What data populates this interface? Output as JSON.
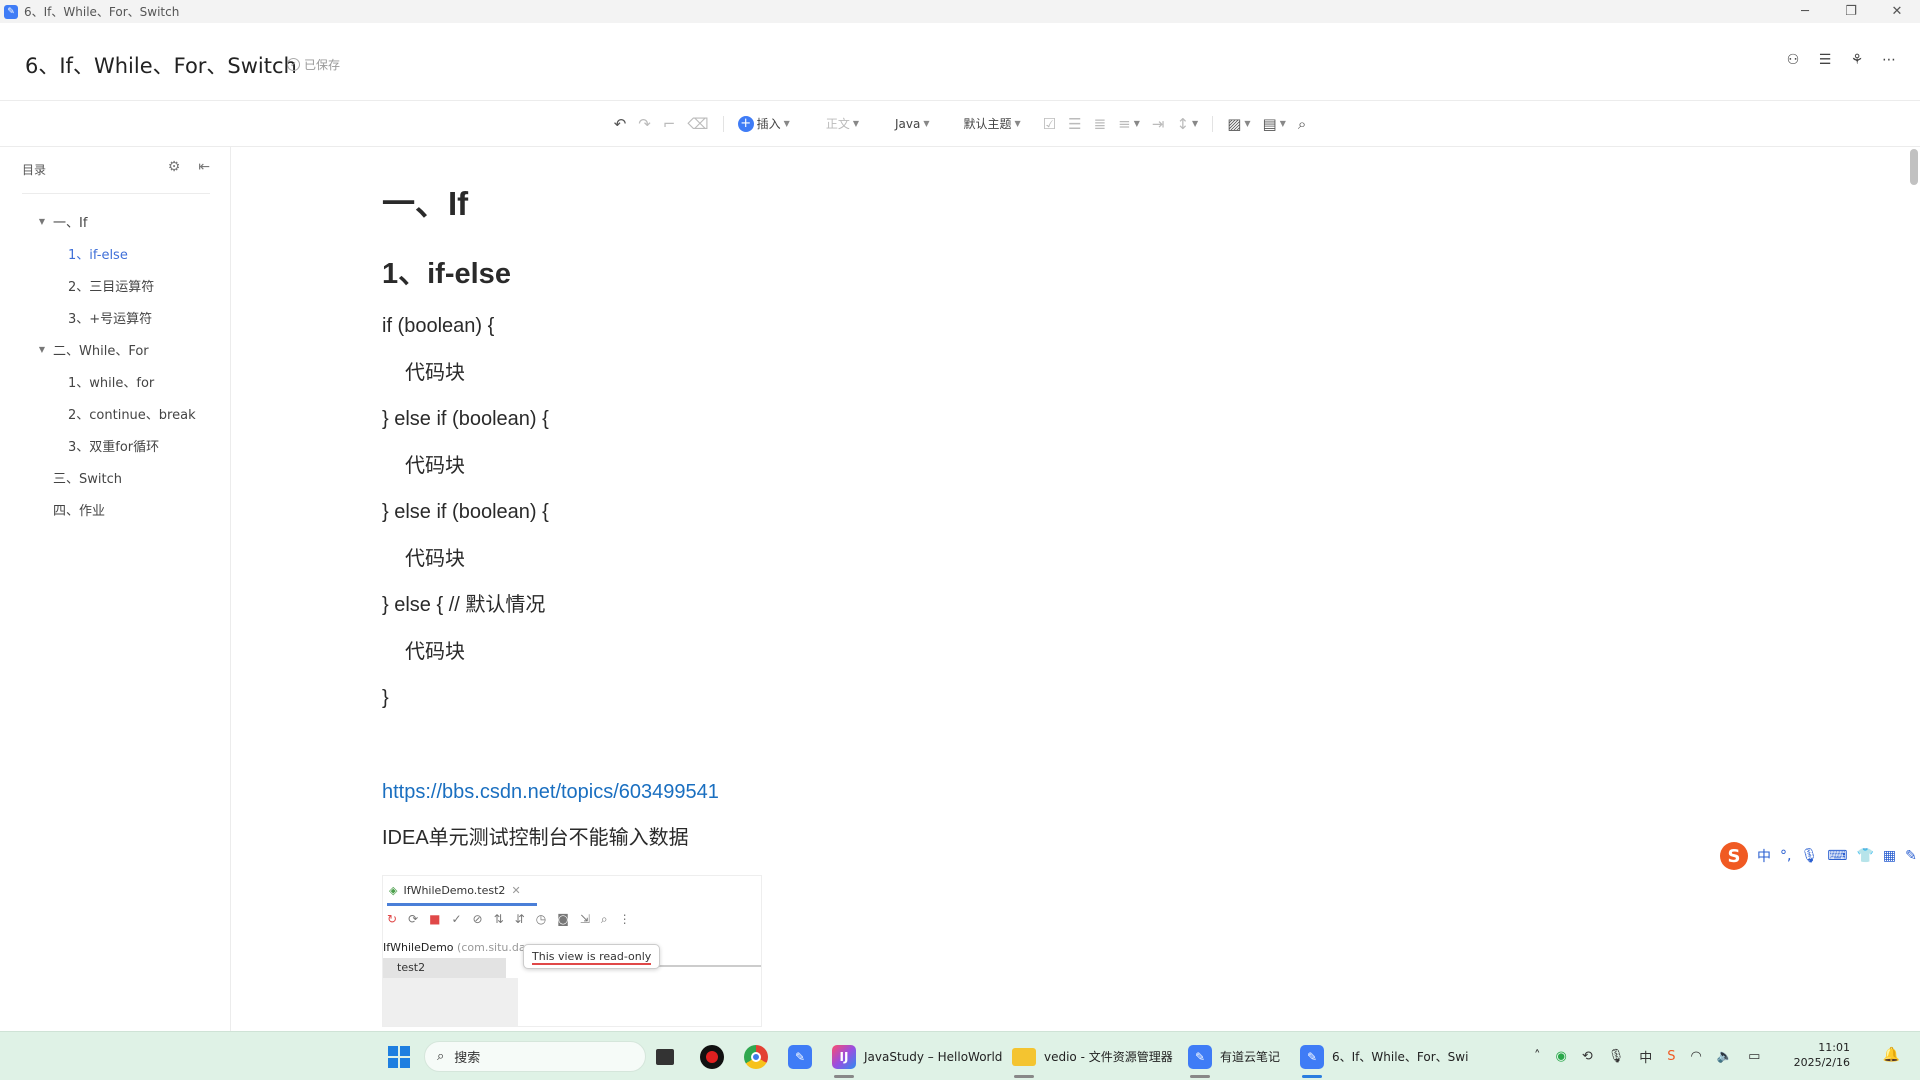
{
  "window": {
    "title": "6、If、While、For、Switch",
    "controls": {
      "minimize": "─",
      "restore": "❐",
      "close": "✕"
    }
  },
  "header": {
    "doc_title": "6、If、While、For、Switch",
    "saved_label": "已保存"
  },
  "toolbar": {
    "insert_label": "插入",
    "paragraph_label": "正文",
    "language_label": "Java",
    "theme_label": "默认主题"
  },
  "toc": {
    "title": "目录",
    "items": [
      {
        "label": "一、If",
        "level": 1,
        "expanded": true
      },
      {
        "label": "1、if-else",
        "level": 2,
        "active": true
      },
      {
        "label": "2、三目运算符",
        "level": 2
      },
      {
        "label": "3、+号运算符",
        "level": 2
      },
      {
        "label": "二、While、For",
        "level": 1,
        "expanded": true
      },
      {
        "label": "1、while、for",
        "level": 2
      },
      {
        "label": "2、continue、break",
        "level": 2
      },
      {
        "label": "3、双重for循环",
        "level": 2
      },
      {
        "label": "三、Switch",
        "level": 1
      },
      {
        "label": "四、作业",
        "level": 1
      }
    ]
  },
  "document": {
    "h1": "一、If",
    "h2": "1、if-else",
    "code_lines": [
      {
        "text": "if (boolean) {",
        "indent": false
      },
      {
        "text": "代码块",
        "indent": true
      },
      {
        "text": "} else if (boolean) {",
        "indent": false
      },
      {
        "text": "代码块",
        "indent": true
      },
      {
        "text": "} else if (boolean) {",
        "indent": false
      },
      {
        "text": "代码块",
        "indent": true
      },
      {
        "text": "} else { // 默认情况",
        "indent": false
      },
      {
        "text": "代码块",
        "indent": true
      },
      {
        "text": "}",
        "indent": false
      }
    ],
    "link": "https://bbs.csdn.net/topics/603499541",
    "note": "IDEA单元测试控制台不能输入数据",
    "embedded": {
      "tab_label": "IfWhileDemo.test2",
      "class_label": "IfWhileDemo",
      "package_label": "(com.situ.da",
      "test_label": "test2",
      "tooltip": "This view is read-only"
    }
  },
  "ime": {
    "lang": "中",
    "punct": "°,"
  },
  "taskbar": {
    "search_placeholder": "搜索",
    "apps": [
      {
        "label": "JavaStudy – HelloWorld"
      },
      {
        "label": "vedio - 文件资源管理器"
      },
      {
        "label": "有道云笔记"
      },
      {
        "label": "6、If、While、For、Swi"
      }
    ],
    "ime_tray": "中",
    "time": "11:01",
    "date": "2025/2/16"
  },
  "colors": {
    "accent": "#3f7cf6",
    "link": "#1a6fc0",
    "toc_active": "#3f6fd8",
    "taskbar_bg": "#dff2e6"
  }
}
